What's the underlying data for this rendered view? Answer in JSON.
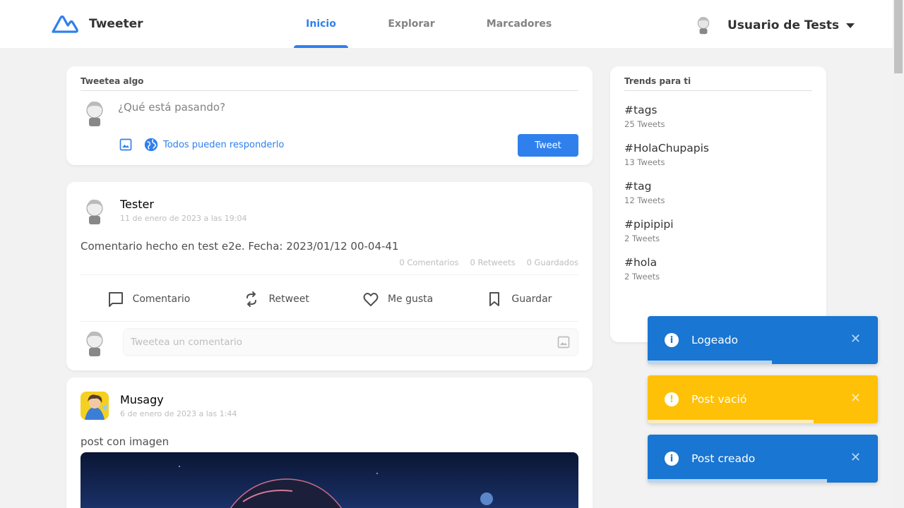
{
  "app": {
    "name": "Tweeter",
    "brand_color": "#2f80ed"
  },
  "nav": {
    "items": [
      {
        "label": "Inicio",
        "active": true
      },
      {
        "label": "Explorar",
        "active": false
      },
      {
        "label": "Marcadores",
        "active": false
      }
    ]
  },
  "user": {
    "name": "Usuario de Tests"
  },
  "compose": {
    "title": "Tweetea algo",
    "placeholder": "¿Qué está pasando?",
    "reply_setting": "Todos pueden responderlo",
    "tweet_label": "Tweet"
  },
  "posts": [
    {
      "author": "Tester",
      "date": "11 de enero de 2023 a las 19:04",
      "text": "Comentario hecho en test e2e. Fecha: 2023/01/12 00-04-41",
      "stats": {
        "comments": "0 Comentarios",
        "retweets": "0 Retweets",
        "saved": "0 Guardados"
      },
      "actions": {
        "comment": "Comentario",
        "retweet": "Retweet",
        "like": "Me gusta",
        "save": "Guardar"
      },
      "reply_placeholder": "Tweetea un comentario"
    },
    {
      "author": "Musagy",
      "date": "6 de enero de 2023 a las 1:44",
      "text": "post con imagen"
    }
  ],
  "trends": {
    "title": "Trends para ti",
    "items": [
      {
        "tag": "#tags",
        "count": "25 Tweets"
      },
      {
        "tag": "#HolaChupapis",
        "count": "13 Tweets"
      },
      {
        "tag": "#tag",
        "count": "12 Tweets"
      },
      {
        "tag": "#pipipipi",
        "count": "2 Tweets"
      },
      {
        "tag": "#hola",
        "count": "2 Tweets"
      }
    ]
  },
  "toasts": [
    {
      "message": "Logeado",
      "type": "info",
      "color": "#1976d2",
      "icon": "info-icon",
      "progress": 0.54
    },
    {
      "message": "Post vació",
      "type": "warning",
      "color": "#ffc107",
      "icon": "warning-icon",
      "progress": 0.72
    },
    {
      "message": "Post creado",
      "type": "info",
      "color": "#1976d2",
      "icon": "info-icon",
      "progress": 0.78
    }
  ]
}
